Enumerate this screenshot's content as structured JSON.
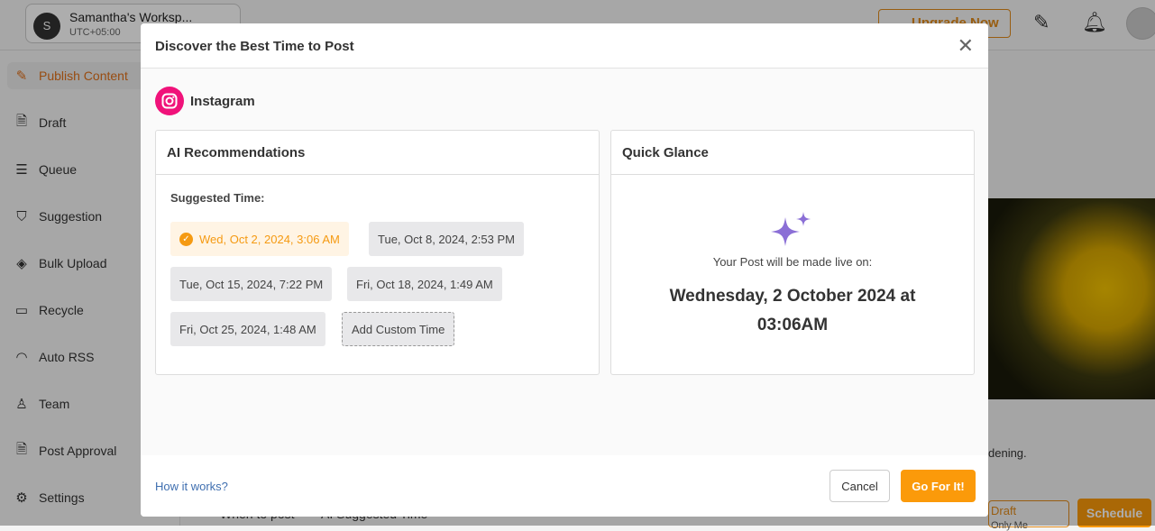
{
  "workspace": {
    "initial": "S",
    "name": "Samantha's Worksp...",
    "timezone": "UTC+05:00"
  },
  "topbar": {
    "upgrade": "Upgrade Now"
  },
  "sidebar": {
    "items": [
      {
        "label": "Publish Content",
        "icon": "pencil-icon",
        "active": true
      },
      {
        "label": "Draft",
        "icon": "document-icon"
      },
      {
        "label": "Queue",
        "icon": "list-icon"
      },
      {
        "label": "Suggestion",
        "icon": "bookmark-icon"
      },
      {
        "label": "Bulk Upload",
        "icon": "layers-icon"
      },
      {
        "label": "Recycle",
        "icon": "archive-icon"
      },
      {
        "label": "Auto RSS",
        "icon": "rss-icon"
      },
      {
        "label": "Team",
        "icon": "user-icon"
      },
      {
        "label": "Post Approval",
        "icon": "check-document-icon"
      },
      {
        "label": "Settings",
        "icon": "gear-icon"
      }
    ]
  },
  "background": {
    "caption_fragment": "dening.",
    "draft": "Draft",
    "only_me": "Only Me",
    "schedule": "Schedule",
    "when_to_post": "When to post",
    "ai_suggested": "AI Suggested Time"
  },
  "modal": {
    "title": "Discover the Best Time to Post",
    "platform": "Instagram",
    "ai": {
      "title": "AI Recommendations",
      "suggested_label": "Suggested Time:",
      "times": [
        "Wed, Oct 2, 2024, 3:06 AM",
        "Tue, Oct 8, 2024, 2:53 PM",
        "Tue, Oct 15, 2024, 7:22 PM",
        "Fri, Oct 18, 2024, 1:49 AM",
        "Fri, Oct 25, 2024, 1:48 AM"
      ],
      "selected_index": 0,
      "custom": "Add Custom Time"
    },
    "glance": {
      "title": "Quick Glance",
      "live_label": "Your Post will be made live on:",
      "date": "Wednesday, 2 October 2024 at 03:06AM"
    },
    "footer": {
      "how": "How it works?",
      "cancel": "Cancel",
      "go": "Go For It!"
    }
  },
  "colors": {
    "accent": "#fb9a0a",
    "instagram": "#f0127a",
    "link": "#3f6fb0",
    "sparkle": "#8b6fd6"
  }
}
